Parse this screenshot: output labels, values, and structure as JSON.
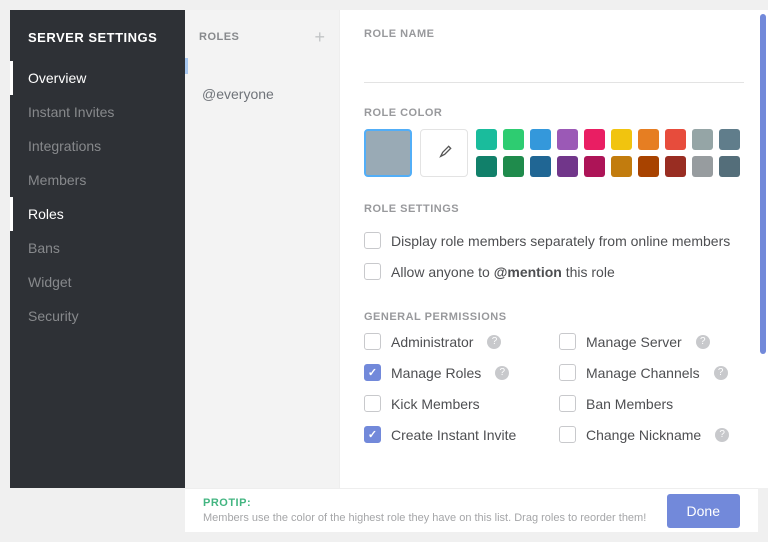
{
  "title": "SERVER SETTINGS",
  "sidebar": {
    "items": [
      {
        "label": "Overview",
        "active": true
      },
      {
        "label": "Instant Invites",
        "active": false
      },
      {
        "label": "Integrations",
        "active": false
      },
      {
        "label": "Members",
        "active": false
      },
      {
        "label": "Roles",
        "active": true
      },
      {
        "label": "Bans",
        "active": false
      },
      {
        "label": "Widget",
        "active": false
      },
      {
        "label": "Security",
        "active": false
      }
    ]
  },
  "rolesList": {
    "header": "ROLES",
    "items": [
      "@everyone"
    ]
  },
  "roleName": {
    "label": "ROLE NAME",
    "value": ""
  },
  "roleColor": {
    "label": "ROLE COLOR",
    "default": "#99aab5",
    "row1": [
      "#1abc9c",
      "#2ecc71",
      "#3498db",
      "#9b59b6",
      "#e91e63",
      "#f1c40f",
      "#e67e22",
      "#e74c3c",
      "#95a5a6",
      "#607d8b"
    ],
    "row2": [
      "#11806a",
      "#1f8b4c",
      "#206694",
      "#71368a",
      "#ad1457",
      "#c27c0e",
      "#a84300",
      "#992d22",
      "#979c9f",
      "#546e7a"
    ]
  },
  "roleSettings": {
    "label": "ROLE SETTINGS",
    "items": [
      {
        "label": "Display role members separately from online members",
        "checked": false
      },
      {
        "label_pre": "Allow anyone to ",
        "label_bold": "@mention",
        "label_post": " this role",
        "checked": false
      }
    ]
  },
  "permissions": {
    "label": "GENERAL PERMISSIONS",
    "items": [
      {
        "label": "Administrator",
        "checked": false,
        "help": true
      },
      {
        "label": "Manage Server",
        "checked": false,
        "help": true
      },
      {
        "label": "Manage Roles",
        "checked": true,
        "help": true
      },
      {
        "label": "Manage Channels",
        "checked": false,
        "help": true
      },
      {
        "label": "Kick Members",
        "checked": false,
        "help": false
      },
      {
        "label": "Ban Members",
        "checked": false,
        "help": false
      },
      {
        "label": "Create Instant Invite",
        "checked": true,
        "help": false
      },
      {
        "label": "Change Nickname",
        "checked": false,
        "help": true
      }
    ]
  },
  "footer": {
    "protip_label": "PROTIP:",
    "protip_text": "Members use the color of the highest role they have on this list. Drag roles to reorder them!",
    "done": "Done"
  }
}
